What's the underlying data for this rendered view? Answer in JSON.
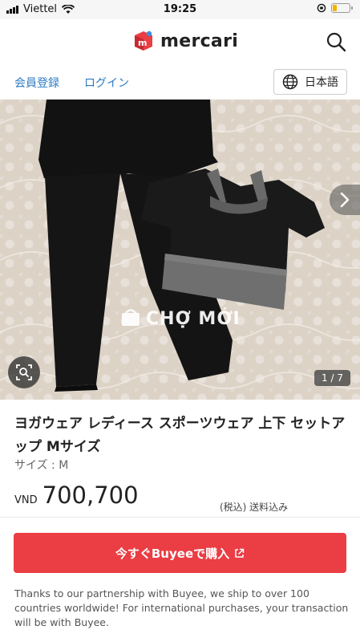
{
  "status_bar": {
    "carrier": "Viettel",
    "time": "19:25",
    "icons": [
      "signal-icon",
      "wifi-icon",
      "orientation-lock-icon",
      "battery-icon"
    ]
  },
  "header": {
    "logo_text": "mercari",
    "icons": [
      "mercari-logo-icon",
      "search-icon"
    ]
  },
  "account": {
    "register_label": "会員登録",
    "login_label": "ログイン",
    "language_label": "日本語",
    "language_icon": "globe-icon"
  },
  "gallery": {
    "page_counter": "1 / 7",
    "watermark": "CHỢ MỚI",
    "icons": [
      "chevron-right-icon",
      "zoom-search-icon"
    ]
  },
  "product": {
    "title": "ヨガウェア レディース スポーツウェア 上下 セットアップ Mサイズ",
    "size": "サイズ : M",
    "currency": "VND",
    "price": "700,700",
    "tax_note": "(税込) 送料込み"
  },
  "buy_button": {
    "label": "今すぐBuyeeで購入",
    "icon": "external-link-icon"
  },
  "shipping_note": "Thanks to our partnership with Buyee, we ship to over 100 countries worldwide! For international purchases, your transaction will be with Buyee.",
  "colors": {
    "accent": "#ea3d44",
    "link": "#2d7bc4",
    "logo_red": "#ea3d44"
  }
}
